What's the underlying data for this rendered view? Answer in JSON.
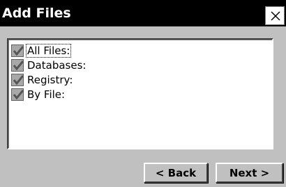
{
  "window": {
    "title": "Add Files",
    "close_glyph": "×"
  },
  "list": {
    "items": [
      {
        "label": "All Files:",
        "checked": true,
        "focused": true,
        "icon": "check-icon"
      },
      {
        "label": "Databases:",
        "checked": true,
        "focused": false,
        "icon": "check-icon"
      },
      {
        "label": "Registry:",
        "checked": true,
        "focused": false,
        "icon": "check-icon"
      },
      {
        "label": "By File:",
        "checked": true,
        "focused": false,
        "icon": "check-icon"
      }
    ]
  },
  "buttons": {
    "back_label": "< Back",
    "next_label": "Next >"
  },
  "colors": {
    "titlebar_bg": "#000000",
    "dialog_bg": "#c0c0c0",
    "list_bg": "#ffffff",
    "checkbox_bg": "#a8a8a8"
  }
}
